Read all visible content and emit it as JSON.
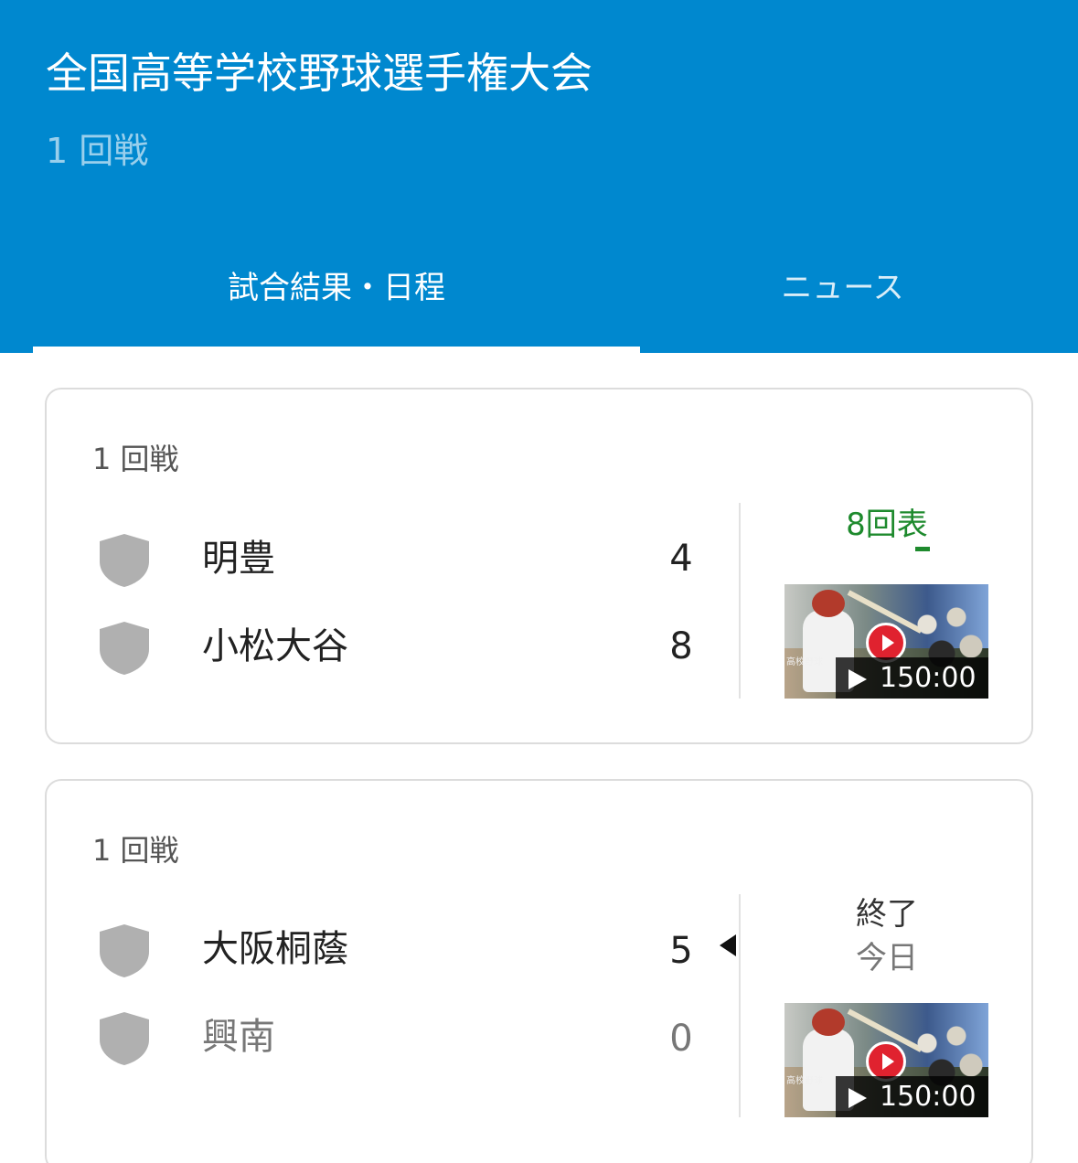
{
  "header": {
    "title": "全国高等学校野球選手権大会",
    "subtitle": "1 回戦",
    "background_color": "#0088cf"
  },
  "tabs": [
    {
      "label": "試合結果・日程",
      "active": true
    },
    {
      "label": "ニュース",
      "active": false
    }
  ],
  "games": [
    {
      "round": "1 回戦",
      "teams": [
        {
          "name": "明豊",
          "score": "4",
          "muted": false,
          "winner": false
        },
        {
          "name": "小松大谷",
          "score": "8",
          "muted": false,
          "winner": false
        }
      ],
      "status": "8回表",
      "status_type": "live",
      "status_color": "#1e8a2d",
      "date": "",
      "video": {
        "duration": "150:00",
        "watermark": "高校野球"
      }
    },
    {
      "round": "1 回戦",
      "teams": [
        {
          "name": "大阪桐蔭",
          "score": "5",
          "muted": false,
          "winner": true
        },
        {
          "name": "興南",
          "score": "0",
          "muted": true,
          "winner": false
        }
      ],
      "status": "終了",
      "status_type": "final",
      "date": "今日",
      "video": {
        "duration": "150:00",
        "watermark": "高校野球"
      }
    }
  ],
  "icons": {
    "team_logo": "shield-icon",
    "play": "play-icon"
  }
}
